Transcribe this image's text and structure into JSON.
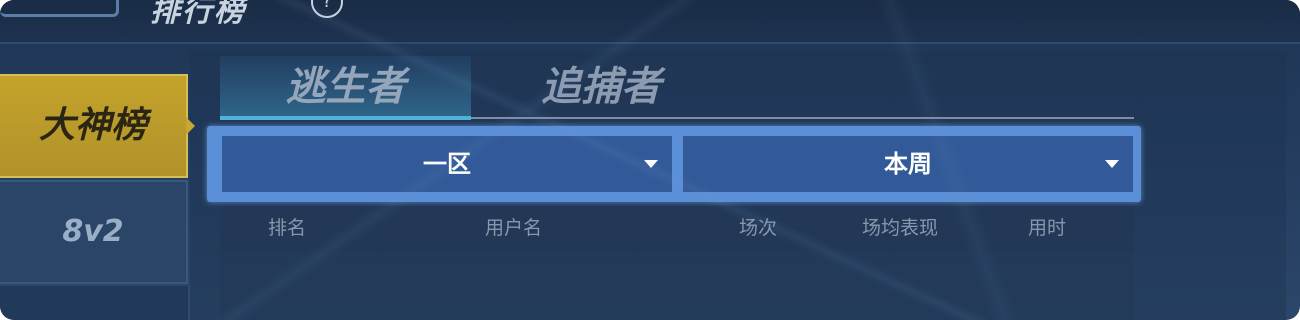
{
  "header": {
    "title": "排行榜",
    "help_icon": "help-circle-icon"
  },
  "nav": {
    "items": [
      {
        "label": "大神榜",
        "active": true
      },
      {
        "label": "8v2",
        "active": false
      }
    ]
  },
  "tabs": [
    {
      "label": "逃生者",
      "active": true
    },
    {
      "label": "追捕者",
      "active": false
    }
  ],
  "filters": {
    "region": "一区",
    "period": "本周"
  },
  "table": {
    "columns": [
      "排名",
      "用户名",
      "场次",
      "场均表现",
      "用时"
    ]
  },
  "colors": {
    "accent_gold": "#c4a32a",
    "dropdown_blue": "#325a98",
    "tab_highlight": "#4fb4d8"
  }
}
